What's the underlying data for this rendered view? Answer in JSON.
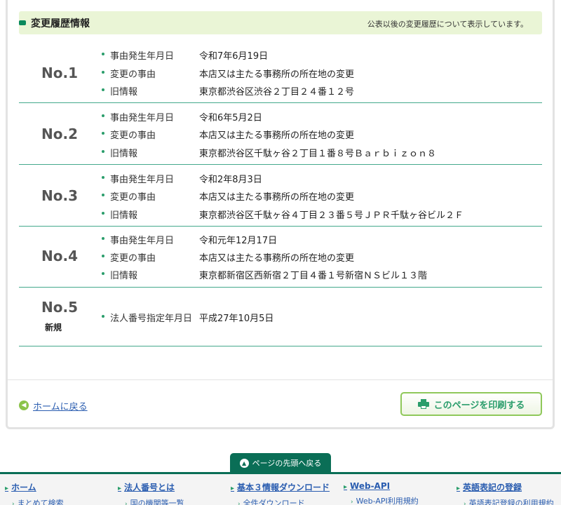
{
  "header": {
    "title": "変更履歴情報",
    "note": "公表以後の変更履歴について表示しています。"
  },
  "entries": [
    {
      "no": "No.1",
      "sub": "",
      "rows": [
        {
          "label": "事由発生年月日",
          "value": "令和7年6月19日"
        },
        {
          "label": "変更の事由",
          "value": "本店又は主たる事務所の所在地の変更"
        },
        {
          "label": "旧情報",
          "value": "東京都渋谷区渋谷２丁目２４番１２号"
        }
      ]
    },
    {
      "no": "No.2",
      "sub": "",
      "rows": [
        {
          "label": "事由発生年月日",
          "value": "令和6年5月2日"
        },
        {
          "label": "変更の事由",
          "value": "本店又は主たる事務所の所在地の変更"
        },
        {
          "label": "旧情報",
          "value": "東京都渋谷区千駄ヶ谷２丁目１番８号Ｂａｒｂｉｚｏｎ８"
        }
      ]
    },
    {
      "no": "No.3",
      "sub": "",
      "rows": [
        {
          "label": "事由発生年月日",
          "value": "令和2年8月3日"
        },
        {
          "label": "変更の事由",
          "value": "本店又は主たる事務所の所在地の変更"
        },
        {
          "label": "旧情報",
          "value": "東京都渋谷区千駄ヶ谷４丁目２３番５号ＪＰＲ千駄ヶ谷ビル２Ｆ"
        }
      ]
    },
    {
      "no": "No.4",
      "sub": "",
      "rows": [
        {
          "label": "事由発生年月日",
          "value": "令和元年12月17日"
        },
        {
          "label": "変更の事由",
          "value": "本店又は主たる事務所の所在地の変更"
        },
        {
          "label": "旧情報",
          "value": "東京都新宿区西新宿２丁目４番１号新宿ＮＳビル１３階"
        }
      ]
    },
    {
      "no": "No.5",
      "sub": "新規",
      "rows": [
        {
          "label": "法人番号指定年月日",
          "value": "平成27年10月5日"
        }
      ]
    }
  ],
  "actions": {
    "home_label": "ホームに戻る",
    "print_label": "このページを印刷する",
    "to_top_label": "ページの先頭へ戻る"
  },
  "footer": {
    "columns": [
      {
        "head": "ホーム",
        "sub": "まとめて検索"
      },
      {
        "head": "法人番号とは",
        "sub": "国の機関等一覧"
      },
      {
        "head": "基本３情報ダウンロード",
        "sub": "全件ダウンロード"
      },
      {
        "head": "Web-API",
        "sub": "Web-API利用規約"
      },
      {
        "head": "英語表記の登録",
        "sub": "英語表記登録の利用規約"
      }
    ]
  },
  "colors": {
    "accent_green": "#2a9d6b",
    "dark_green": "#0a6e56",
    "header_bg": "#eaf5d6",
    "link_blue": "#2a5db0"
  }
}
